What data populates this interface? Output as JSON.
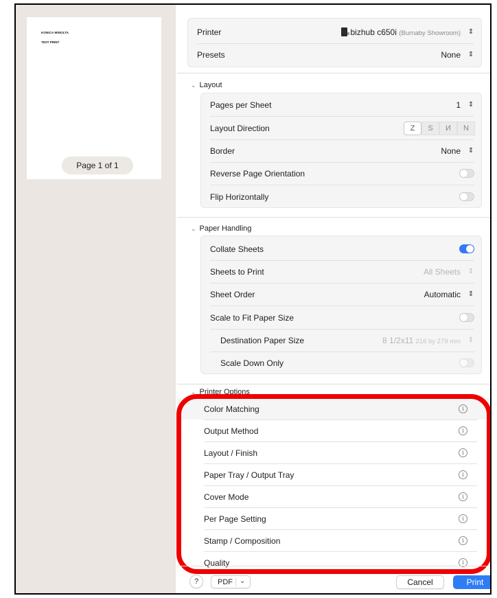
{
  "preview": {
    "paper_line1": "KONICA MINOLTA",
    "paper_line2": "TEST PRINT",
    "page_badge": "Page 1 of 1"
  },
  "top": {
    "printer_label": "Printer",
    "printer_name": "bizhub c650i",
    "printer_location": "(Burnaby Showroom)",
    "presets_label": "Presets",
    "presets_value": "None"
  },
  "layout": {
    "title": "Layout",
    "pages_per_sheet_label": "Pages per Sheet",
    "pages_per_sheet_value": "1",
    "direction_label": "Layout Direction",
    "direction_options": [
      "Z",
      "S",
      "И",
      "N"
    ],
    "border_label": "Border",
    "border_value": "None",
    "reverse_label": "Reverse Page Orientation",
    "reverse_on": false,
    "flip_label": "Flip Horizontally",
    "flip_on": false
  },
  "paper": {
    "title": "Paper Handling",
    "collate_label": "Collate Sheets",
    "collate_on": true,
    "sheets_label": "Sheets to Print",
    "sheets_value": "All Sheets",
    "order_label": "Sheet Order",
    "order_value": "Automatic",
    "scale_label": "Scale to Fit Paper Size",
    "scale_on": false,
    "dest_label": "Destination Paper Size",
    "dest_value": "8 1/2x11",
    "dest_detail": "216 by 279 mm",
    "scale_down_label": "Scale Down Only",
    "scale_down_on": false
  },
  "printer_options": {
    "title": "Printer Options",
    "items": [
      "Color Matching",
      "Output Method",
      "Layout / Finish",
      "Paper Tray / Output Tray",
      "Cover Mode",
      "Per Page Setting",
      "Stamp / Composition",
      "Quality"
    ]
  },
  "footer": {
    "help": "?",
    "pdf": "PDF",
    "cancel": "Cancel",
    "print": "Print"
  },
  "colors": {
    "accent": "#2f7df6",
    "highlight": "#ee0000",
    "preview_bg": "#ebe6e1"
  }
}
